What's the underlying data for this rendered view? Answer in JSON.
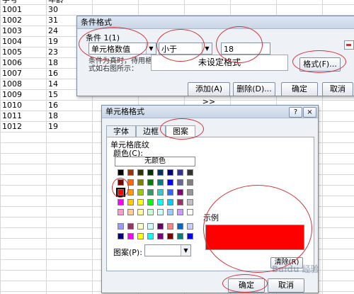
{
  "sheet": {
    "header": {
      "col_a": "学号",
      "col_b": "年龄"
    },
    "rows": [
      {
        "a": "1001",
        "b": "30"
      },
      {
        "a": "1002",
        "b": "31"
      },
      {
        "a": "1003",
        "b": "24"
      },
      {
        "a": "1004",
        "b": "19"
      },
      {
        "a": "1005",
        "b": "23"
      },
      {
        "a": "1006",
        "b": "18"
      },
      {
        "a": "1007",
        "b": "16"
      },
      {
        "a": "1008",
        "b": "14"
      },
      {
        "a": "1009",
        "b": "15"
      },
      {
        "a": "1010",
        "b": "16"
      },
      {
        "a": "1011",
        "b": "18"
      },
      {
        "a": "1012",
        "b": "19"
      }
    ]
  },
  "cond_dialog": {
    "title": "条件格式",
    "condition_label": "条件 1(1)",
    "type_value": "单元格数值",
    "operator_value": "小于",
    "threshold_value": "18",
    "preview_label": "条件为真时，待用格式如右图所示：",
    "preview_text": "未设定格式",
    "format_button": "格式(F)...",
    "add_button": "添加(A) >>",
    "delete_button": "删除(D)...",
    "ok_button": "确定",
    "cancel_button": "取消"
  },
  "cell_dialog": {
    "title": "单元格格式",
    "help_icon": "?",
    "close_icon": "×",
    "tabs": [
      "字体",
      "边框",
      "图案"
    ],
    "active_tab": "图案",
    "section_label": "单元格底纹",
    "color_label": "颜色(C):",
    "no_color": "无颜色",
    "sample_label": "示例",
    "sample_color": "#ff0000",
    "pattern_label": "图案(P):",
    "clear_button": "清除(R)",
    "ok_button": "确定",
    "cancel_button": "取消",
    "watermark": "Baidu 经验"
  },
  "palette": {
    "main_rows": [
      [
        "#000000",
        "#993300",
        "#333300",
        "#003300",
        "#003366",
        "#000080",
        "#333399",
        "#333333"
      ],
      [
        "#800000",
        "#ff6600",
        "#808000",
        "#008000",
        "#008080",
        "#0000ff",
        "#666699",
        "#808080"
      ],
      [
        "#ff0000",
        "#ff9900",
        "#99cc00",
        "#339966",
        "#33cccc",
        "#3366ff",
        "#800080",
        "#969696"
      ],
      [
        "#ff00ff",
        "#ffcc00",
        "#ffff00",
        "#00ff00",
        "#00ffff",
        "#00ccff",
        "#993366",
        "#c0c0c0"
      ],
      [
        "#ff99cc",
        "#ffcc99",
        "#ffff99",
        "#ccffcc",
        "#ccffff",
        "#99ccff",
        "#cc99ff",
        "#ffffff"
      ]
    ],
    "extra_rows": [
      [
        "#9999ff",
        "#993366",
        "#ffffcc",
        "#ccffff",
        "#660066",
        "#ff8080",
        "#0066cc",
        "#ccccff"
      ],
      [
        "#000080",
        "#ff00ff",
        "#ffff00",
        "#00ffff",
        "#800080",
        "#800000",
        "#008080",
        "#0000ff"
      ]
    ],
    "selected": "#ff0000"
  }
}
